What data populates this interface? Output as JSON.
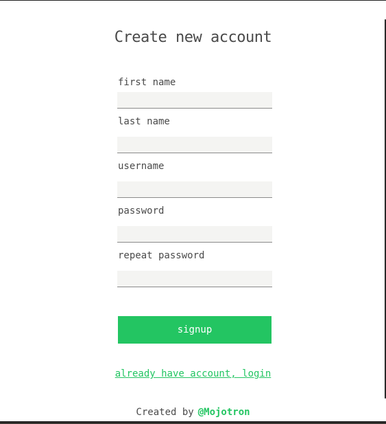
{
  "form": {
    "title": "Create new account",
    "fields": [
      {
        "label": "first name",
        "value": "",
        "placeholder": ""
      },
      {
        "label": "last name",
        "value": "",
        "placeholder": ""
      },
      {
        "label": "username",
        "value": "",
        "placeholder": ""
      },
      {
        "label": "password",
        "value": "",
        "placeholder": ""
      },
      {
        "label": "repeat password",
        "value": "",
        "placeholder": ""
      }
    ],
    "submit_label": "signup",
    "login_link": "already have account, login"
  },
  "footer": {
    "prefix": "Created by",
    "author": "@Mojotron"
  },
  "colors": {
    "accent": "#23c562",
    "text": "#4a4a4a",
    "input_bg": "#f4f4f2"
  }
}
